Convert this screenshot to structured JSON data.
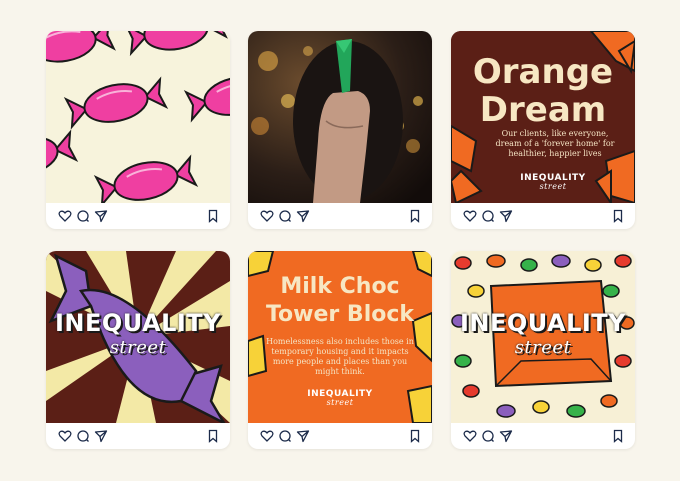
{
  "posts": [
    {
      "id": "pink-candy-pattern"
    },
    {
      "id": "hand-photo"
    },
    {
      "title_line1": "Orange",
      "title_line2": "Dream",
      "body": "Our clients, like everyone, dream of a 'forever home' for healthier, happier lives",
      "brand_line1": "INEQUALITY",
      "brand_line2": "street"
    },
    {
      "brand_line1": "INEQUALITY",
      "brand_line2": "street"
    },
    {
      "title_line1": "Milk Choc",
      "title_line2": "Tower Block",
      "body": "Homelessness also includes those in temporary housing and it impacts more people and places than you might think.",
      "brand_line1": "INEQUALITY",
      "brand_line2": "street"
    },
    {
      "brand_line1": "INEQUALITY",
      "brand_line2": "street"
    }
  ],
  "colors": {
    "background": "#f8f5ec",
    "candy_pink": "#ef3fa1",
    "maroon": "#5b1f16",
    "orange": "#f06a22",
    "purple": "#8b5fbd",
    "cream": "#f7e7c3"
  },
  "icons": [
    "heart-icon",
    "comment-icon",
    "share-icon",
    "bookmark-icon"
  ]
}
